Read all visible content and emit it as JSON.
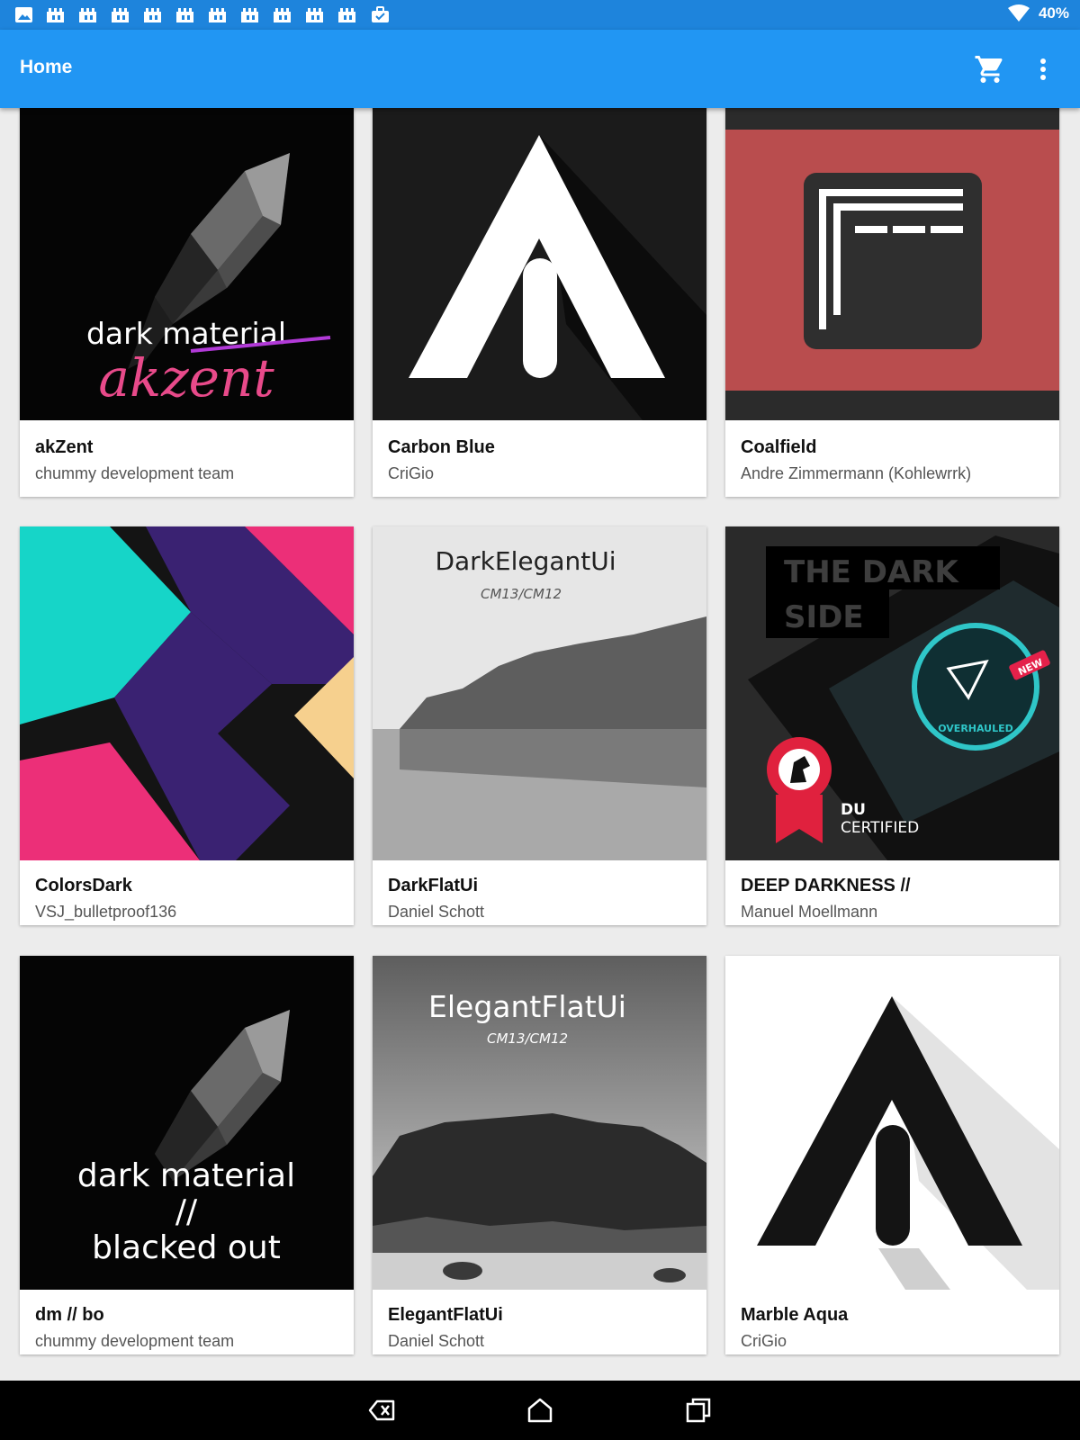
{
  "status_bar": {
    "notification_icons": [
      "image-icon",
      "castle-icon",
      "castle-icon",
      "castle-icon",
      "castle-icon",
      "castle-icon",
      "castle-icon",
      "castle-icon",
      "castle-icon",
      "castle-icon",
      "castle-icon",
      "briefcase-icon"
    ],
    "battery": "40%"
  },
  "app_bar": {
    "title": "Home",
    "color": "#2196f3"
  },
  "themes": [
    {
      "title": "akZent",
      "author": "chummy development team",
      "art": {
        "line1": "dark material",
        "line2": "akzent"
      }
    },
    {
      "title": "Carbon Blue",
      "author": "CriGio"
    },
    {
      "title": "Coalfield",
      "author": "Andre Zimmermann (Kohlewrrk)"
    },
    {
      "title": "ColorsDark",
      "author": "VSJ_bulletproof136"
    },
    {
      "title": "DarkFlatUi",
      "author": "Daniel Schott",
      "art": {
        "heading": "DarkElegantUi",
        "sub": "CM13/CM12"
      }
    },
    {
      "title": "DEEP DARKNESS //",
      "author": "Manuel Moellmann",
      "art": {
        "line1": "THE DARK",
        "line2": "SIDE",
        "badge": "NEW",
        "ring": "OVERHAULED",
        "cert1": "DU",
        "cert2": "CERTIFIED"
      }
    },
    {
      "title": "dm // bo",
      "author": "chummy development team",
      "art": {
        "line1": "dark material",
        "line2": "//",
        "line3": "blacked out"
      }
    },
    {
      "title": "ElegantFlatUi",
      "author": "Daniel Schott",
      "art": {
        "heading": "ElegantFlatUi",
        "sub": "CM13/CM12"
      }
    },
    {
      "title": "Marble Aqua",
      "author": "CriGio"
    }
  ]
}
